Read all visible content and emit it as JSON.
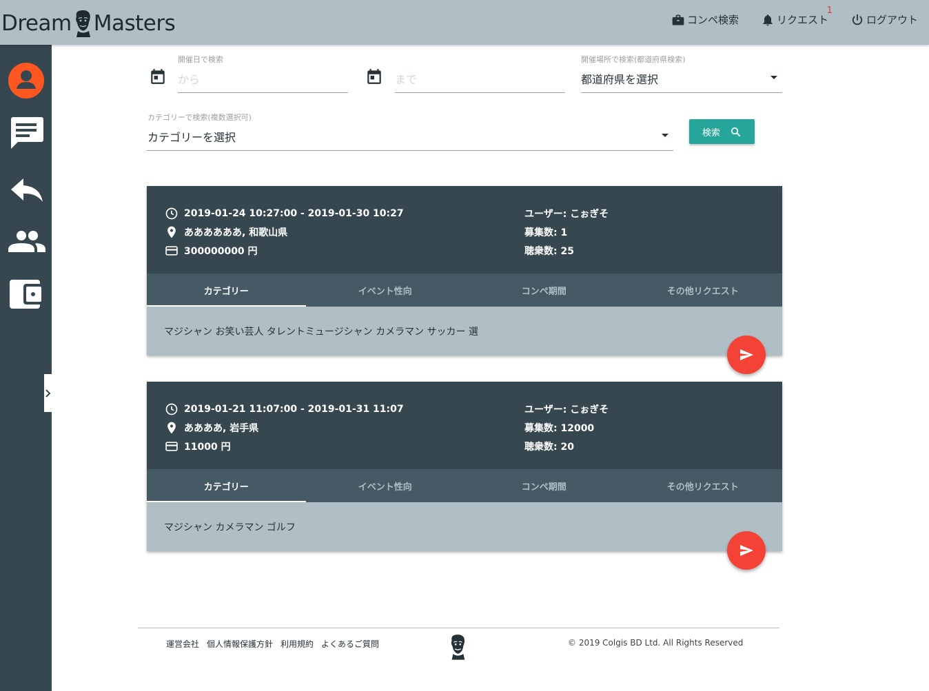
{
  "header": {
    "logo_left": "Dream",
    "logo_right": "Masters",
    "nav": {
      "contest_search": "コンペ検索",
      "requests": "リクエスト",
      "requests_badge": "1",
      "logout": "ログアウト"
    }
  },
  "sidebar": {
    "icons": [
      "account-icon",
      "message-icon",
      "reply-icon",
      "group-icon",
      "wallet-icon"
    ],
    "toggle_icon": "chevron-right-icon"
  },
  "search": {
    "date_label": "開催日で検索",
    "from_placeholder": "から",
    "to_placeholder": "まで",
    "location_label": "開催場所で検索(都道府県検索)",
    "location_value": "都道府県を選択",
    "category_label": "カテゴリーで検索(複数選択可)",
    "category_value": "カテゴリーを選択",
    "button_label": "検索"
  },
  "cards": [
    {
      "period": "2019-01-24 10:27:00 - 2019-01-30 10:27",
      "location": "ああああああ, 和歌山県",
      "price": "300000000 円",
      "user": "ユーザー: こぉぎそ",
      "recruit": "募集数: 1",
      "audience": "聴衆数: 25",
      "tabs": [
        "カテゴリー",
        "イベント性向",
        "コンペ期間",
        "その他リクエスト"
      ],
      "content": "マジシャン お笑い芸人 タレントミュージシャン カメラマン サッカー 選"
    },
    {
      "period": "2019-01-21 11:07:00 - 2019-01-31 11:07",
      "location": "ああああ, 岩手県",
      "price": "11000 円",
      "user": "ユーザー: こぉぎそ",
      "recruit": "募集数: 12000",
      "audience": "聴衆数: 20",
      "tabs": [
        "カテゴリー",
        "イベント性向",
        "コンペ期間",
        "その他リクエスト"
      ],
      "content": "マジシャン カメラマン ゴルフ"
    }
  ],
  "footer": {
    "links": [
      "運営会社",
      "個人情報保護方針",
      "利用規約",
      "よくあるご質問"
    ],
    "copyright": "© 2019 Colgis BD Ltd. All Rights Reserved"
  },
  "colors": {
    "header_bg": "#b0bec5",
    "sidebar_bg": "#37474f",
    "card_bg": "#37474f",
    "tab_bg": "#455a64",
    "accent_teal": "#26a69a",
    "fab_red": "#f44336",
    "account_orange": "#ff5722"
  }
}
